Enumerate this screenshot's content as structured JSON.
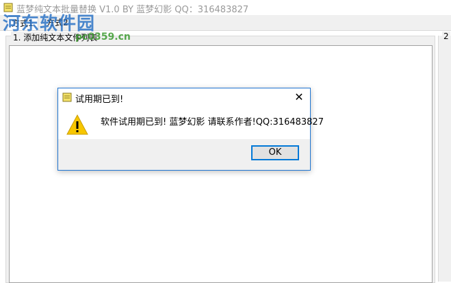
{
  "window": {
    "title": "蓝梦纯文本批量替换 V1.0 BY 蓝梦幻影 QQ：316483827"
  },
  "tabs": [
    {
      "label": "方式1"
    },
    {
      "label": "方式2"
    }
  ],
  "groups": {
    "left_title": "1. 添加纯文本文件列表",
    "right_title": "2"
  },
  "watermark": {
    "text": "河东软件园",
    "url": "pc0359.cn"
  },
  "dialog": {
    "title": "试用期已到!",
    "close_label": "✕",
    "message": "软件试用期已到! 蓝梦幻影 请联系作者!QQ:316483827",
    "ok_label": "OK"
  },
  "colors": {
    "accent": "#0078d7",
    "dialog_border": "#1e74d1",
    "warning": "#f7c600"
  }
}
